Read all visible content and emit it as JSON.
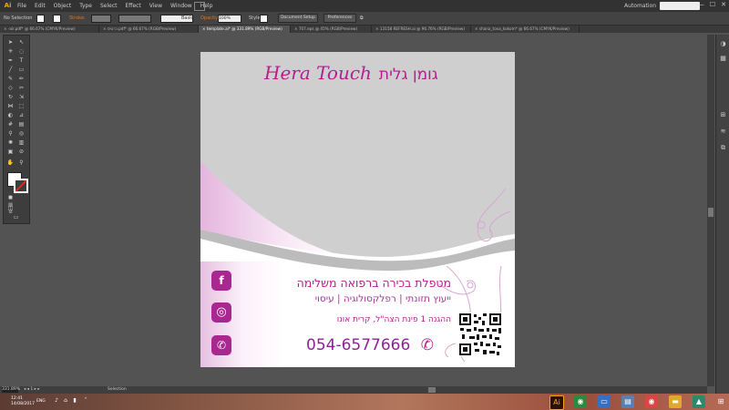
{
  "app": {
    "logo": "Ai"
  },
  "menubar": {
    "menus": [
      "File",
      "Edit",
      "Object",
      "Type",
      "Select",
      "Effect",
      "View",
      "Window",
      "Help"
    ],
    "workspace": "Automation",
    "wincontrols": [
      "—",
      "☐",
      "✕"
    ]
  },
  "controlbar": {
    "selection": "No Selection",
    "stroke_label": "Stroke:",
    "brush_label": "Basic",
    "opacity_label": "Opacity:",
    "opacity_value": "100%",
    "style_label": "Style:",
    "doc_setup": "Document Setup",
    "preferences": "Preferences"
  },
  "tabs": [
    {
      "label": "× -air.pdf* @ 66.67% (CMYK/Preview)",
      "active": false
    },
    {
      "label": "× כרטיס.pdf* @ 66.67% (RGB/Preview)",
      "active": false
    },
    {
      "label": "× template.ai* @ 331.89% (RGB/Preview)",
      "active": true
    },
    {
      "label": "× 707.eps @ 45% (RGB/Preview)",
      "active": false
    },
    {
      "label": "× 13158 REFRESH.ai @ 96.76% (RGB/Preview)",
      "active": false
    },
    {
      "label": "× shana_tova_kokom* @ 66.67% (CMYK/Preview)",
      "active": false
    }
  ],
  "statusbar": {
    "zoom": "331.89%",
    "mode": "Selection"
  },
  "taskbar": {
    "time": "12:41",
    "date": "14/08/2017",
    "lang": "ENG"
  },
  "card": {
    "title_latin": "Hera Touch",
    "title_hebrew": "גומן גלית",
    "line1": "מטפלת בכירה ברפואה משלימה",
    "line2": "ייעוץ תזונתי | רפלקסולוגיה | עיסוי",
    "line3": "ההגנה 1 פינת הצה\"ל, קרית אונו",
    "phone": "054-6577666",
    "social": [
      "f",
      "◎",
      "✆"
    ],
    "colors": {
      "magenta": "#b41e8f",
      "purple": "#8f2395",
      "grey": "#cfcfcf"
    }
  },
  "icons": {
    "phone": "phone-icon",
    "facebook": "facebook-icon",
    "instagram": "instagram-icon",
    "whatsapp": "whatsapp-icon"
  }
}
